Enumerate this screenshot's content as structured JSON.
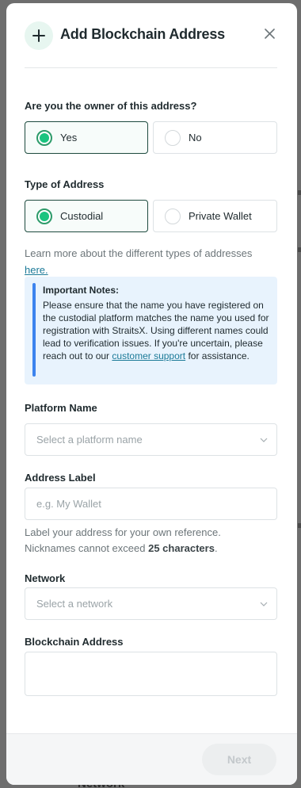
{
  "backdrop": {
    "fragment_text": "Network"
  },
  "modal": {
    "title": "Add Blockchain Address",
    "icons": {
      "header": "plus-icon",
      "close": "close-icon",
      "chevron": "chevron-down-icon"
    },
    "colors": {
      "accent": "#19c47f",
      "selected_border": "#1d4a3e",
      "info_bar": "#3c83ee",
      "info_bg": "#e8f3fd",
      "link": "#1b7a98"
    }
  },
  "owner": {
    "question": "Are you the owner of this address?",
    "options": [
      {
        "label": "Yes",
        "selected": true
      },
      {
        "label": "No",
        "selected": false
      }
    ]
  },
  "address_type": {
    "question": "Type of Address",
    "options": [
      {
        "label": "Custodial",
        "selected": true
      },
      {
        "label": "Private Wallet",
        "selected": false
      }
    ],
    "learn_more_text": "Learn more about the different types of addresses",
    "learn_more_link": "here."
  },
  "notes": {
    "title": "Important Notes:",
    "body": "Please ensure that the name you have registered on the custodial platform matches the name you used for registration with StraitsX. Using different names could lead to verification issues. If you're uncertain, please reach out to our",
    "link": "customer support",
    "suffix": "for assistance."
  },
  "platform": {
    "label": "Platform Name",
    "placeholder": "Select a platform name"
  },
  "address_label": {
    "label": "Address Label",
    "placeholder": "e.g. My Wallet",
    "helper_line1": "Label your address for your own reference.",
    "helper_line2_prefix": "Nicknames cannot exceed",
    "helper_line2_bold": "25 characters",
    "helper_line2_suffix": "."
  },
  "network": {
    "label": "Network",
    "placeholder": "Select a network"
  },
  "blockchain_address": {
    "label": "Blockchain Address",
    "value": ""
  },
  "footer": {
    "next_label": "Next"
  }
}
